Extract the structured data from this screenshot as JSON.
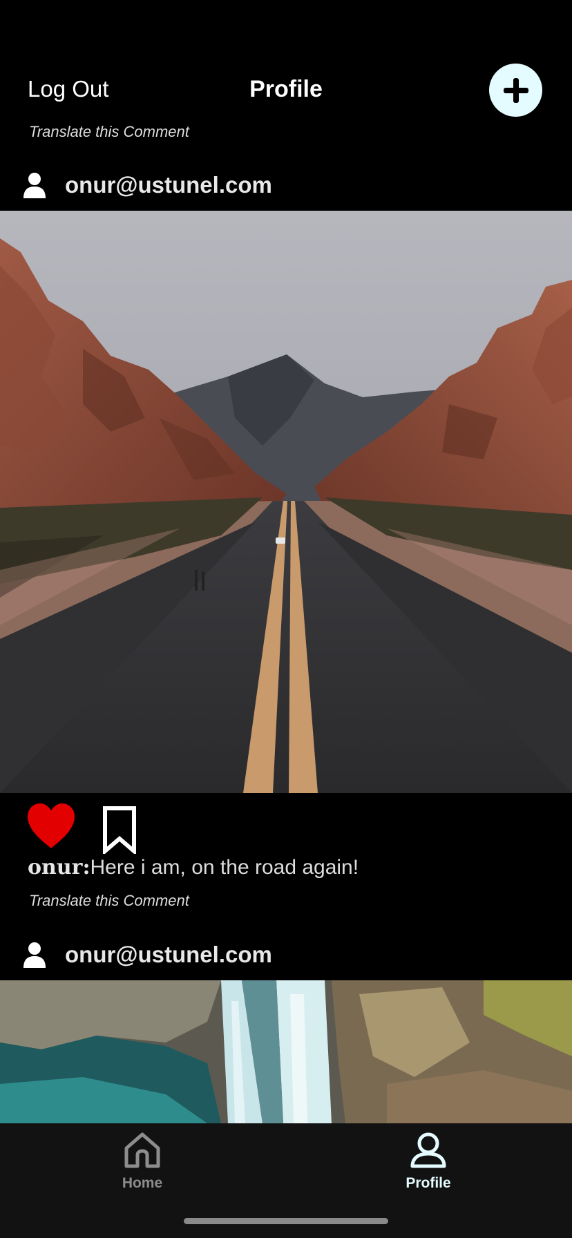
{
  "header": {
    "logout_label": "Log Out",
    "title": "Profile",
    "add_icon": "plus-icon"
  },
  "posts": [
    {
      "translate_label": "Translate this Comment",
      "user_email": "onur@ustunel.com",
      "image": "desert-road-photo",
      "liked": true,
      "caption_user": "onur:",
      "caption_text": "Here i am, on the road again!",
      "caption_translate_label": "Translate this Comment"
    },
    {
      "user_email": "onur@ustunel.com",
      "image": "waterfall-photo"
    }
  ],
  "tabbar": {
    "tabs": [
      {
        "label": "Home",
        "icon": "home-icon",
        "active": false
      },
      {
        "label": "Profile",
        "icon": "person-icon",
        "active": true
      }
    ]
  },
  "colors": {
    "background": "#000000",
    "tabbar": "#121212",
    "accent": "#e4fbff",
    "heart": "#e30000",
    "inactive_tab": "#8d8d8d"
  }
}
